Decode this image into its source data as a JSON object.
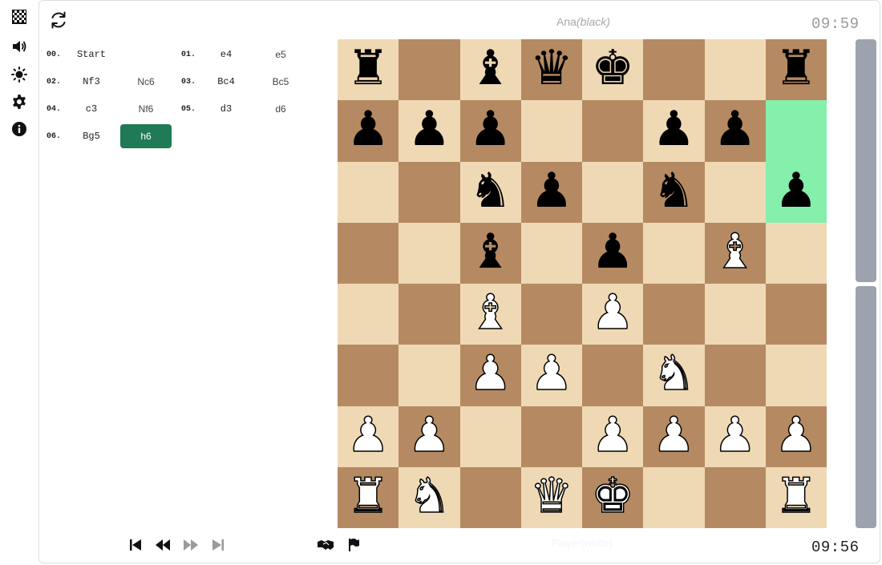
{
  "sidebar": {
    "icons": [
      "board-icon",
      "sound-icon",
      "brightness-icon",
      "settings-icon",
      "info-icon"
    ]
  },
  "header": {
    "opponent_name": "Ana",
    "opponent_color": "(black)",
    "opponent_clock": "09:59"
  },
  "footer": {
    "player_name": "Player(white)",
    "player_clock": "09:56"
  },
  "moves": [
    {
      "num": "00.",
      "white": "Start",
      "black": ""
    },
    {
      "num": "01.",
      "white": "e4",
      "black": "e5"
    },
    {
      "num": "02.",
      "white": "Nf3",
      "black": "Nc6"
    },
    {
      "num": "03.",
      "white": "Bc4",
      "black": "Bc5"
    },
    {
      "num": "04.",
      "white": "c3",
      "black": "Nf6"
    },
    {
      "num": "05.",
      "white": "d3",
      "black": "d6"
    },
    {
      "num": "06.",
      "white": "Bg5",
      "black": "h6"
    }
  ],
  "active_move": "h6",
  "board": {
    "files": [
      "a",
      "b",
      "c",
      "d",
      "e",
      "f",
      "g",
      "h"
    ],
    "ranks": [
      [
        "r",
        "",
        "b",
        "q",
        "k",
        "",
        "",
        "r"
      ],
      [
        "p",
        "p",
        "p",
        "",
        "",
        "p",
        "p",
        ""
      ],
      [
        "",
        "",
        "n",
        "p",
        "",
        "n",
        "",
        "p"
      ],
      [
        "",
        "",
        "b",
        "",
        "p",
        "",
        "B",
        ""
      ],
      [
        "",
        "",
        "B",
        "",
        "P",
        "",
        "",
        ""
      ],
      [
        "",
        "",
        "P",
        "P",
        "",
        "N",
        "",
        ""
      ],
      [
        "P",
        "P",
        "",
        "",
        "P",
        "P",
        "P",
        "P"
      ],
      [
        "R",
        "N",
        "",
        "Q",
        "K",
        "",
        "",
        "R"
      ]
    ],
    "highlight": [
      "h7",
      "h6"
    ],
    "light_color": "#efd9b4",
    "dark_color": "#b58a62",
    "highlight_color": "#85efac"
  },
  "colors": {
    "active_move_bg": "#1f7a55",
    "eval_bar": "#9ca3af"
  }
}
